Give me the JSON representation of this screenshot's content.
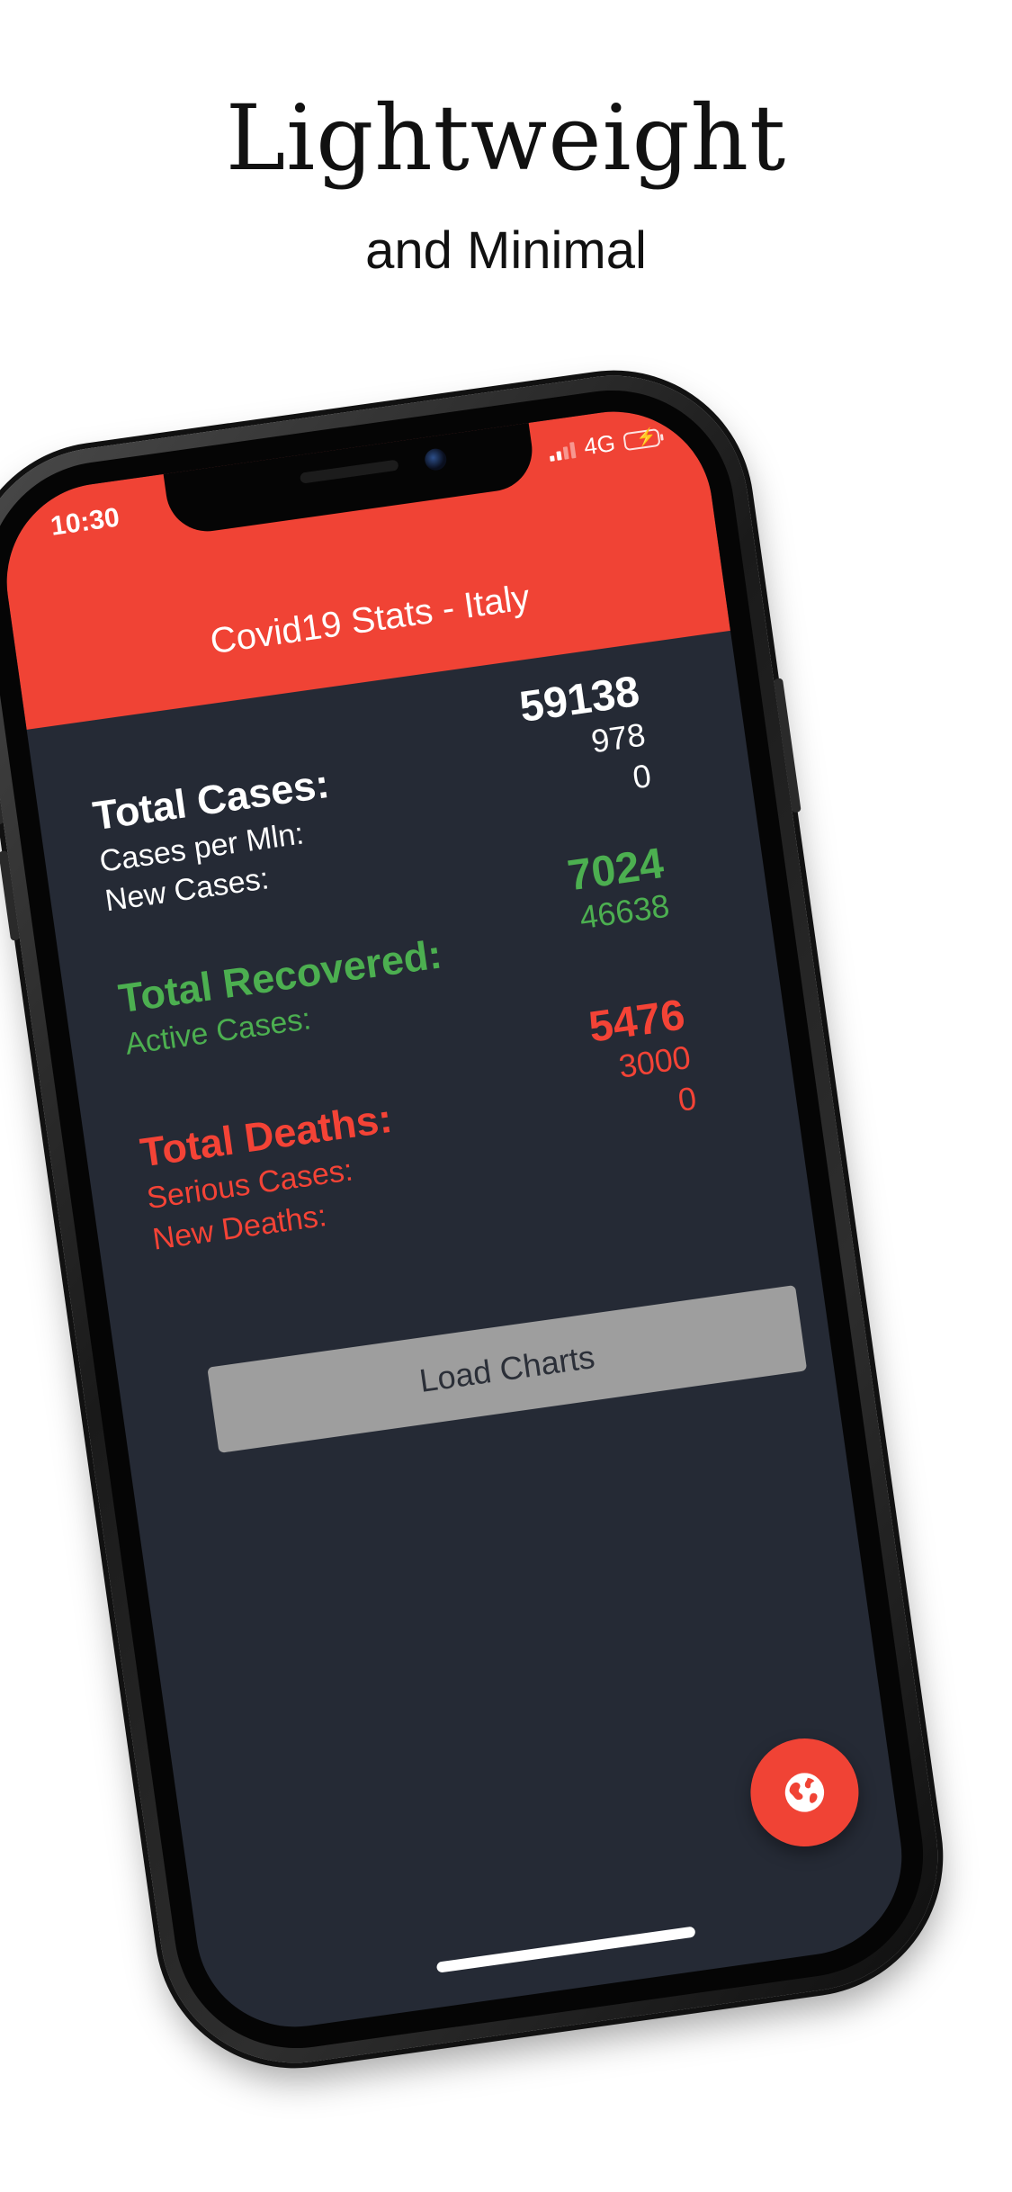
{
  "promo": {
    "headline": "Lightweight",
    "subline": "and Minimal"
  },
  "status_bar": {
    "time": "10:30",
    "network": "4G",
    "icons": [
      "signal-icon",
      "battery-charging-icon"
    ]
  },
  "app": {
    "title": "Covid19 Stats - Italy"
  },
  "stats": {
    "cases": {
      "total_label": "Total Cases:",
      "per_mln_label": "Cases per Mln:",
      "new_label": "New Cases:",
      "total_value": "59138",
      "per_mln_value": "978",
      "new_value": "0"
    },
    "recovered": {
      "total_label": "Total Recovered:",
      "active_label": "Active Cases:",
      "total_value": "7024",
      "active_value": "46638"
    },
    "deaths": {
      "total_label": "Total Deaths:",
      "serious_label": "Serious Cases:",
      "new_label": "New Deaths:",
      "total_value": "5476",
      "serious_value": "3000",
      "new_value": "0"
    }
  },
  "actions": {
    "load_charts_label": "Load Charts",
    "fab_icon": "globe-icon"
  },
  "colors": {
    "accent": "#f04335",
    "background": "#252a35",
    "recovered": "#4caf50",
    "deaths": "#f44336",
    "button": "#9e9e9e"
  }
}
